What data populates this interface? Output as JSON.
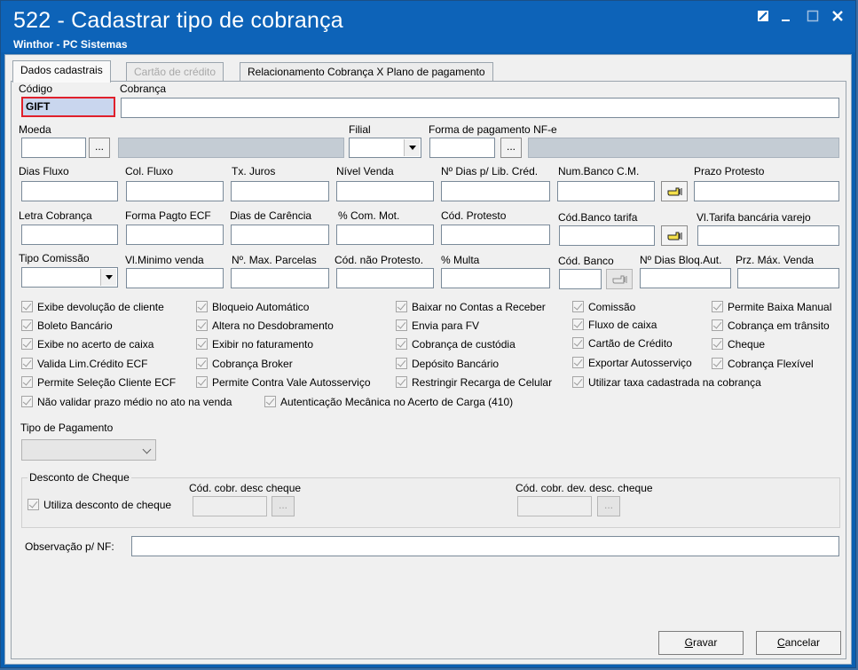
{
  "window": {
    "title": "522 - Cadastrar tipo de cobrança",
    "subtitle": "Winthor - PC Sistemas",
    "controls": [
      "restore-icon",
      "minimize-icon",
      "maximize-icon",
      "close-icon"
    ]
  },
  "tabs": [
    {
      "label": "Dados cadastrais",
      "state": "active"
    },
    {
      "label": "Cartão de crédito",
      "state": "disabled"
    },
    {
      "label": "Relacionamento Cobrança X Plano de pagamento",
      "state": "normal"
    }
  ],
  "fields": {
    "codigo": {
      "label": "Código",
      "value": "GIFT"
    },
    "cobranca": {
      "label": "Cobrança",
      "value": ""
    },
    "moeda": {
      "label": "Moeda",
      "value": "",
      "button": "..."
    },
    "filial": {
      "label": "Filial",
      "value": ""
    },
    "forma_pagamento_nfe": {
      "label": "Forma de pagamento NF-e",
      "value": "",
      "button": "..."
    },
    "dias_fluxo": {
      "label": "Dias Fluxo"
    },
    "col_fluxo": {
      "label": "Col. Fluxo"
    },
    "tx_juros": {
      "label": "Tx. Juros"
    },
    "nivel_venda": {
      "label": "Nível Venda"
    },
    "n_dias_lib_cred": {
      "label": "Nº Dias p/ Lib. Créd."
    },
    "num_banco_cm": {
      "label": "Num.Banco C.M."
    },
    "prazo_protesto": {
      "label": "Prazo Protesto"
    },
    "letra_cobranca": {
      "label": "Letra Cobrança"
    },
    "forma_pagto_ecf": {
      "label": "Forma Pagto ECF"
    },
    "dias_carencia": {
      "label": "Dias de Carência"
    },
    "com_mot": {
      "label": "% Com. Mot."
    },
    "cod_protesto": {
      "label": "Cód. Protesto"
    },
    "cod_banco_tarifa": {
      "label": "Cód.Banco tarifa"
    },
    "vl_tarifa_bancaria": {
      "label": "Vl.Tarifa bancária varejo"
    },
    "tipo_comissao": {
      "label": "Tipo Comissão"
    },
    "vl_minimo_venda": {
      "label": "Vl.Minimo venda"
    },
    "n_max_parcelas": {
      "label": "Nº. Max. Parcelas"
    },
    "cod_nao_protesto": {
      "label": "Cód. não Protesto."
    },
    "multa": {
      "label": "% Multa"
    },
    "cod_banco": {
      "label": "Cód. Banco"
    },
    "n_dias_bloq_aut": {
      "label": "Nº Dias Bloq.Aut."
    },
    "prz_max_venda": {
      "label": "Prz. Máx. Venda"
    }
  },
  "checkboxes": {
    "col1": [
      "Exibe devolução de cliente",
      "Boleto Bancário",
      "Exibe no acerto de caixa",
      "Valida Lim.Crédito ECF",
      "Permite Seleção Cliente ECF"
    ],
    "col2": [
      "Bloqueio Automático",
      "Altera no Desdobramento",
      "Exibir no faturamento",
      "Cobrança Broker",
      "Permite Contra Vale Autosserviço"
    ],
    "col3": [
      "Baixar no Contas a Receber",
      "Envia para FV",
      "Cobrança de custódia",
      "Depósito Bancário",
      "Restringir Recarga de Celular"
    ],
    "col4": [
      "Comissão",
      "Fluxo de caixa",
      "Cartão de Crédito",
      "Exportar Autosserviço",
      "Utilizar taxa cadastrada na cobrança"
    ],
    "col5": [
      "Permite Baixa Manual",
      "Cobrança em trânsito",
      "Cheque",
      "Cobrança Flexível"
    ],
    "bottom": [
      "Não validar prazo médio no ato na venda",
      "Autenticação Mecânica no Acerto de Carga (410)"
    ]
  },
  "tipo_pagamento": {
    "label": "Tipo de Pagamento",
    "value": ""
  },
  "desconto_cheque": {
    "title": "Desconto de Cheque",
    "checkbox": "Utiliza desconto de cheque",
    "cod_cobr_desc_label": "Cód. cobr. desc cheque",
    "cod_cobr_dev_label": "Cód. cobr. dev. desc. cheque",
    "button": "..."
  },
  "observacao": {
    "label": "Observação p/ NF:",
    "value": ""
  },
  "actions": {
    "gravar": {
      "access_key": "G",
      "rest": "ravar"
    },
    "cancelar": {
      "access_key": "C",
      "rest": "ancelar"
    }
  }
}
